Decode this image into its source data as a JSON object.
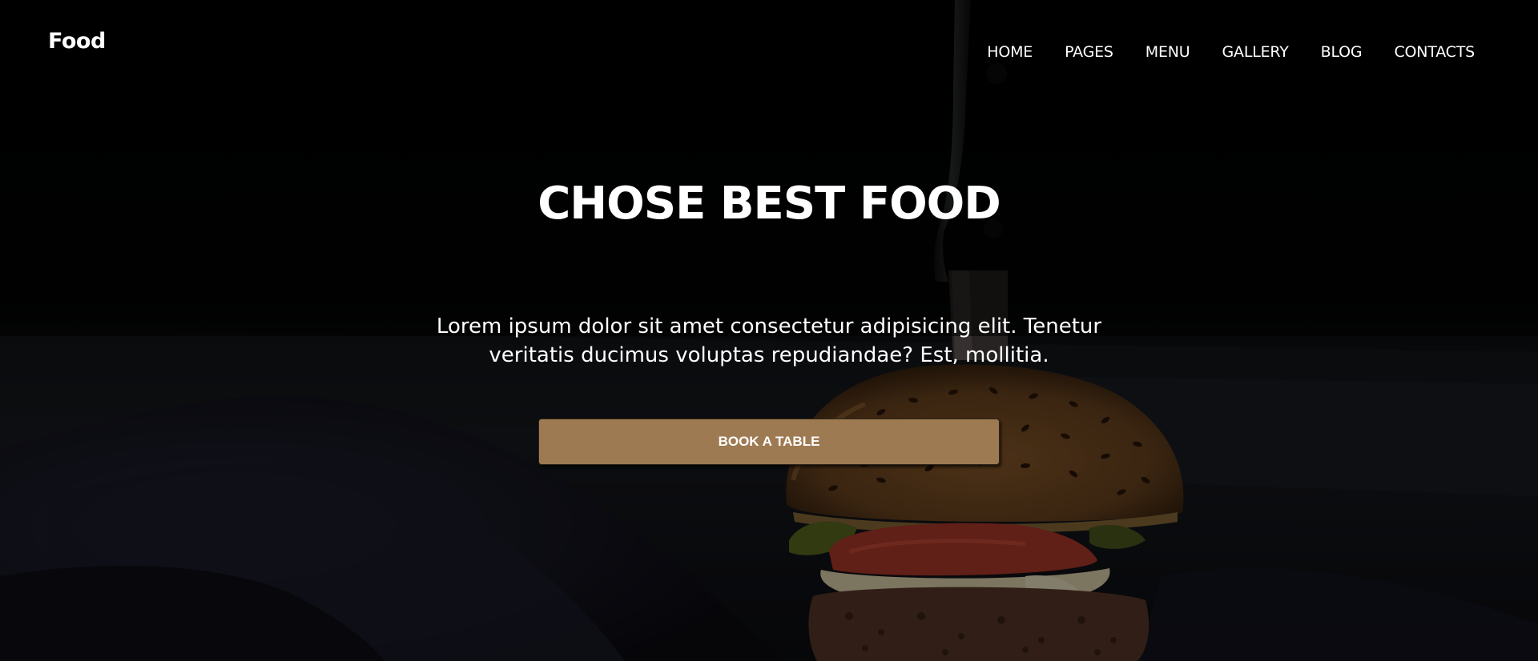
{
  "brand": {
    "logo": "Food"
  },
  "nav": {
    "items": [
      {
        "label": "HOME"
      },
      {
        "label": "PAGES"
      },
      {
        "label": "MENU"
      },
      {
        "label": "GALLERY"
      },
      {
        "label": "BLOG"
      },
      {
        "label": "CONTACTS"
      }
    ]
  },
  "hero": {
    "title": "CHOSE BEST FOOD",
    "lead_line1": "Lorem ipsum dolor sit amet consectetur adipisicing elit. Tenetur",
    "lead_line2": "veritatis ducimus voluptas repudiandae? Est, mollitia.",
    "cta_label": "BOOK A TABLE"
  },
  "colors": {
    "cta_background": "#9e7a52",
    "overlay": "#000000",
    "text": "#ffffff"
  },
  "icons": {
    "background_image": "burger-with-knife-photo"
  }
}
